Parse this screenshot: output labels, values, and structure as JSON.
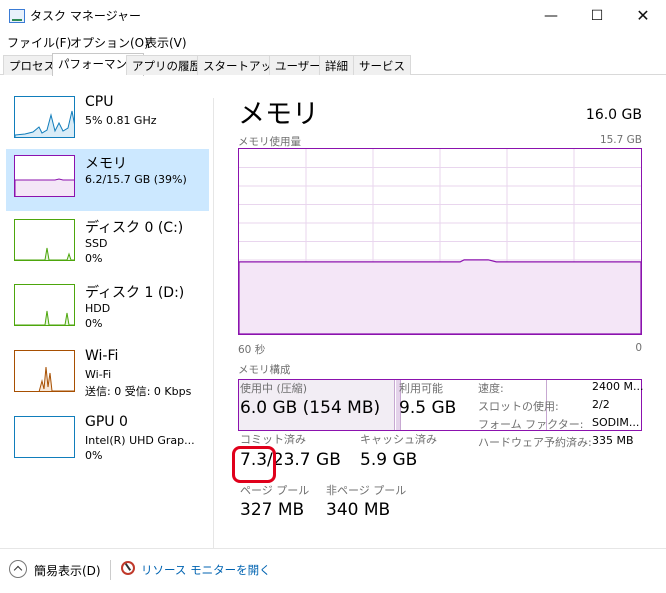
{
  "window": {
    "title": "タスク マネージャー",
    "min_glyph": "—",
    "max_glyph": "☐",
    "close_glyph": "✕"
  },
  "menu": [
    "ファイル(F)",
    "オプション(O)",
    "表示(V)"
  ],
  "tabs": [
    "プロセス",
    "パフォーマンス",
    "アプリの履歴",
    "スタートアップ",
    "ユーザー",
    "詳細",
    "サービス"
  ],
  "active_tab": "パフォーマンス",
  "sidebar": [
    {
      "name": "CPU",
      "sub1": "5%  0.81 GHz",
      "sub2": ""
    },
    {
      "name": "メモリ",
      "sub1": "6.2/15.7 GB (39%)",
      "sub2": ""
    },
    {
      "name": "ディスク 0 (C:)",
      "sub1": "SSD",
      "sub2": "0%"
    },
    {
      "name": "ディスク 1 (D:)",
      "sub1": "HDD",
      "sub2": "0%"
    },
    {
      "name": "Wi-Fi",
      "sub1": "Wi-Fi",
      "sub2": "送信: 0 受信: 0 Kbps"
    },
    {
      "name": "GPU 0",
      "sub1": "Intel(R) UHD Grap...",
      "sub2": "0%"
    }
  ],
  "memory": {
    "title": "メモリ",
    "total": "16.0 GB",
    "usage_label": "メモリ使用量",
    "usage_max": "15.7 GB",
    "time_left": "60 秒",
    "time_right": "0",
    "usage_level_fraction": 0.39,
    "composition_label": "メモリ構成",
    "stats": {
      "in_use_label": "使用中 (圧縮)",
      "in_use_value": "6.0 GB (154 MB)",
      "available_label": "利用可能",
      "available_value": "9.5 GB",
      "committed_label": "コミット済み",
      "committed_value": "7.3/23.7 GB",
      "cached_label": "キャッシュ済み",
      "cached_value": "5.9 GB",
      "paged_label": "ページ プール",
      "paged_value": "327 MB",
      "nonpaged_label": "非ページ プール",
      "nonpaged_value": "340 MB"
    },
    "details": [
      {
        "label": "速度:",
        "value": "2400 M..."
      },
      {
        "label": "スロットの使用:",
        "value": "2/2"
      },
      {
        "label": "フォーム ファクター:",
        "value": "SODIM..."
      },
      {
        "label": "ハードウェア予約済み:",
        "value": "335 MB"
      }
    ]
  },
  "footer": {
    "fewer_details": "簡易表示(D)",
    "resource_monitor": "リソース モニターを開く"
  },
  "colors": {
    "memory_purple": "#8b12ae",
    "cpu_blue": "#117dbb",
    "disk_green": "#4da60c",
    "wifi_orange": "#a74f01",
    "selected_bg": "#cce8ff",
    "highlight_red": "#e0001b"
  },
  "icons": [
    "task-manager-icon",
    "chevron-up-icon",
    "resource-monitor-icon"
  ]
}
